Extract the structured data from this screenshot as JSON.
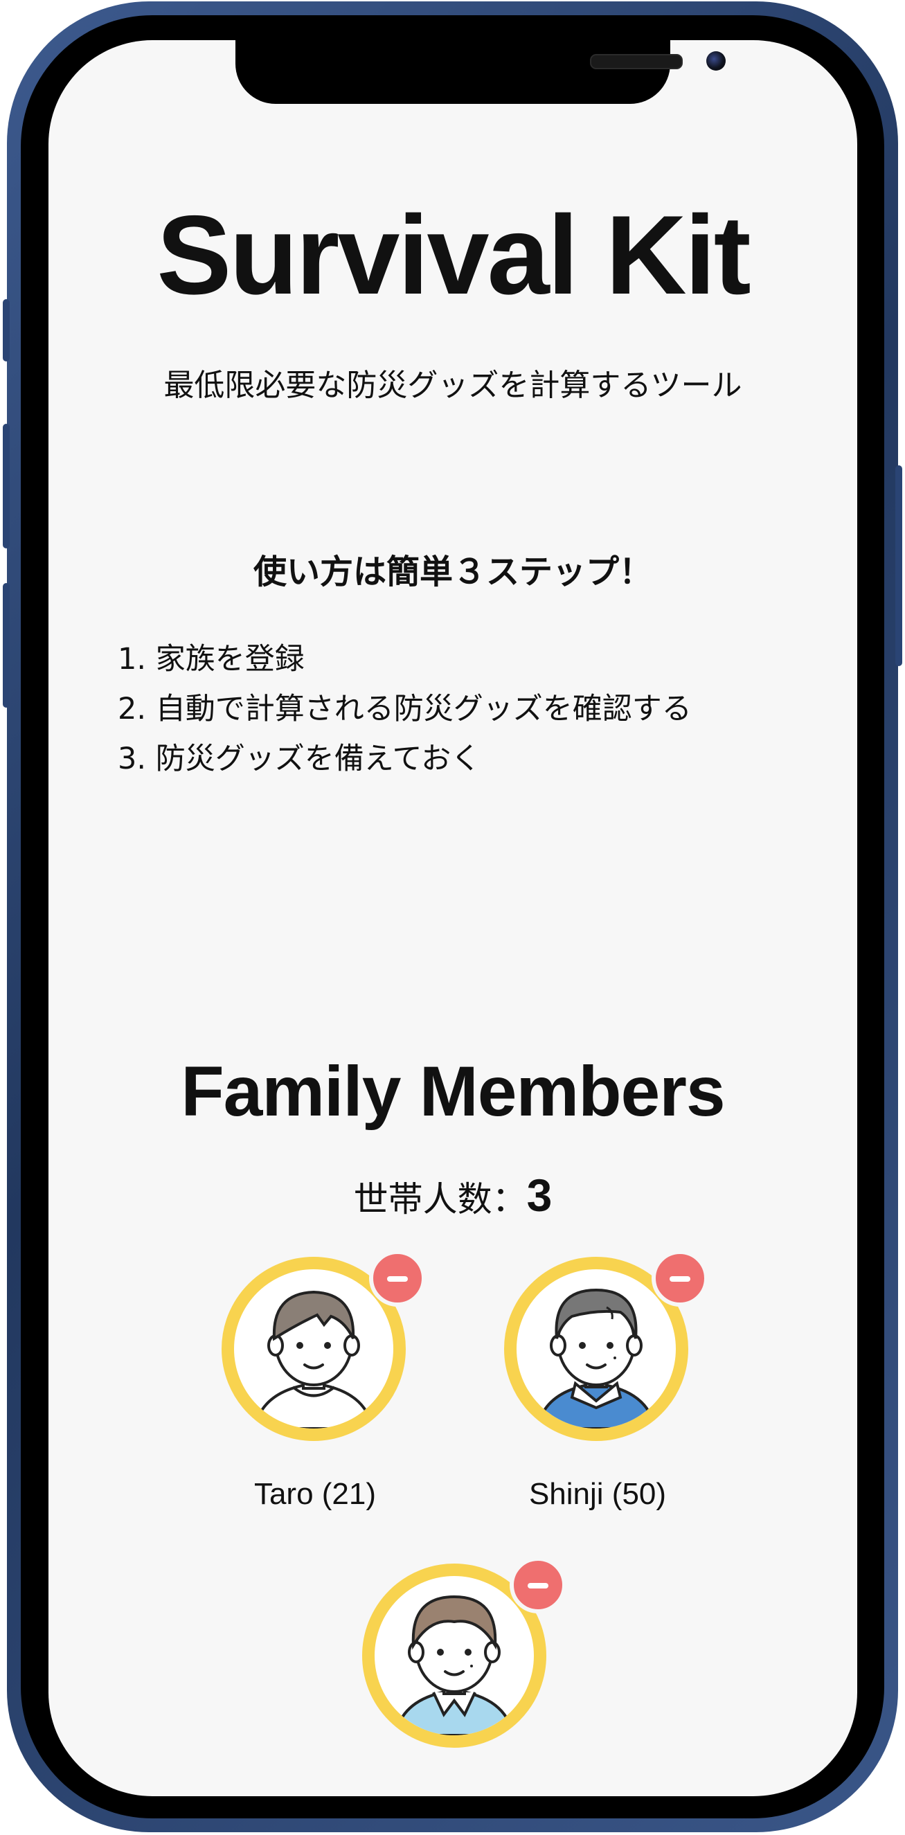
{
  "app": {
    "title": "Survival Kit",
    "subtitle": "最低限必要な防災グッズを計算するツール"
  },
  "howto": {
    "heading": "使い方は簡単３ステップ！",
    "steps": [
      "1. 家族を登録",
      "2. 自動で計算される防災グッズを確認する",
      "3. 防災グッズを備えておく"
    ]
  },
  "family": {
    "title": "Family Members",
    "household_label": "世帯人数：",
    "household_count": "3",
    "members": [
      {
        "name": "Taro (21)",
        "avatar_icon": "young-man-avatar-icon",
        "remove_icon": "minus-circle-icon"
      },
      {
        "name": "Shinji (50)",
        "avatar_icon": "middle-aged-man-avatar-icon",
        "remove_icon": "minus-circle-icon"
      },
      {
        "name": "",
        "avatar_icon": "woman-avatar-icon",
        "remove_icon": "minus-circle-icon"
      }
    ]
  },
  "colors": {
    "avatar_ring": "#f8d34f",
    "remove_button": "#ef6f6f",
    "phone_frame": "#2f4b7c",
    "screen_background": "#f7f7f7"
  }
}
